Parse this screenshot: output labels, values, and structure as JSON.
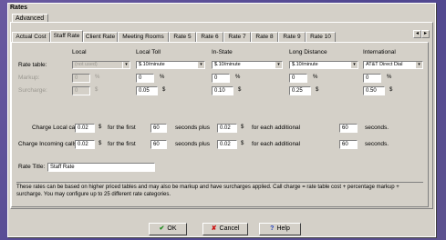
{
  "window": {
    "title": "Rates"
  },
  "top_tab": "Advanced",
  "tabs": [
    "Actual Cost",
    "Staff Rate",
    "Client Rate",
    "Meeting Rooms",
    "Rate 5",
    "Rate 6",
    "Rate 7",
    "Rate 8",
    "Rate 9",
    "Rate 10"
  ],
  "active_tab": "Staff Rate",
  "scroll": {
    "left": "◂",
    "right": "▸"
  },
  "columns": [
    "Local",
    "Local Toll",
    "In-State",
    "Long Distance",
    "International"
  ],
  "row_labels": {
    "rate_table": "Rate table:",
    "markup": "Markup:",
    "surcharge": "Surcharge:"
  },
  "rate_table": [
    "(not used)",
    "$.10/minute",
    "$.10/minute",
    "$.10/minute",
    "AT&T Direct Dial"
  ],
  "markup": [
    "0",
    "0",
    "0",
    "0",
    "0"
  ],
  "surcharge": [
    "0",
    "0.05",
    "0.10",
    "0.25",
    "0.50"
  ],
  "units": {
    "percent": "%",
    "dollar": "$"
  },
  "charge_local": {
    "label": "Charge Local calls",
    "first_amount": "0.02",
    "dollar": "$",
    "for_first": "for the first",
    "first_seconds": "60",
    "seconds_plus": "seconds plus",
    "add_amount": "0.02",
    "for_each": "for each additional",
    "add_seconds": "60",
    "seconds": "seconds."
  },
  "charge_incoming": {
    "label": "Charge Incoming calls",
    "first_amount": "0.02",
    "dollar": "$",
    "for_first": "for the first",
    "first_seconds": "60",
    "seconds_plus": "seconds plus",
    "add_amount": "0.02",
    "for_each": "for each additional",
    "add_seconds": "60",
    "seconds": "seconds."
  },
  "rate_title": {
    "label": "Rate Title:",
    "value": "Staff Rate"
  },
  "note": "These rates can be based on higher priced tables and may also be markup and have surcharges applied. Call charge = rate table cost + percentage markup + surcharge. You may configure up to 25 different rate categories.",
  "buttons": {
    "ok": "OK",
    "cancel": "Cancel",
    "help": "Help"
  },
  "colors": {
    "ok_icon": "#1a8a1a",
    "cancel_icon": "#cc1111",
    "help_icon": "#1f3fbf"
  }
}
